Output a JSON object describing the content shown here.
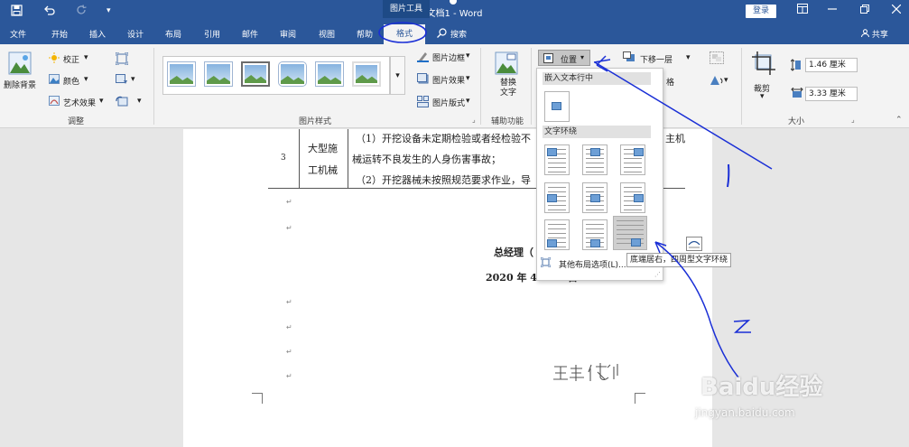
{
  "titlebar": {
    "doc_title": "文档1 - Word",
    "context_tab": "图片工具",
    "login": "登录"
  },
  "tabs": {
    "file": "文件",
    "home": "开始",
    "insert": "插入",
    "design": "设计",
    "layout": "布局",
    "references": "引用",
    "mailings": "邮件",
    "review": "审阅",
    "view": "视图",
    "help": "帮助",
    "format": "格式",
    "search": "搜索",
    "share": "共享"
  },
  "ribbon": {
    "adjust": {
      "remove_bg": "删除背景",
      "corrections": "校正",
      "color": "颜色",
      "artistic": "艺术效果",
      "group_label": "调整"
    },
    "styles": {
      "border": "图片边框",
      "effects": "图片效果",
      "layout": "图片版式",
      "group_label": "图片样式"
    },
    "accessibility": {
      "alt_text": "替换文字",
      "group_label": "辅助功能"
    },
    "arrange": {
      "position": "位置",
      "send_backward": "下移一层",
      "align_partial": "格"
    },
    "size": {
      "crop": "裁剪",
      "height": "1.46 厘米",
      "width": "3.33 厘米",
      "group_label": "大小"
    }
  },
  "position_menu": {
    "inline_header": "嵌入文本行中",
    "wrap_header": "文字环绕",
    "more_options": "其他布局选项(L)...",
    "tooltip": "底端居右，四周型文字环绕"
  },
  "document": {
    "row_number": "3",
    "cell_line1": "大型施",
    "cell_line2": "工机械",
    "text_line1": "（1）开挖设备未定期检验或者经检验不",
    "text_line1_tail": "主机",
    "text_line2": "械运转不良发生的人身伤害事故；",
    "text_line3": "（2）开挖器械未按照规范要求作业，导",
    "signer": "总经理（",
    "date_start": "2020 年 4",
    "date_end": "日",
    "signature": "王丰城"
  },
  "annotations": {
    "mark1": "1",
    "mark2": "2"
  },
  "watermark": {
    "brand": "Baidu经验",
    "url": "jingyan.baidu.com"
  },
  "colors": {
    "title_blue": "#2b579a",
    "ribbon_bg": "#f3f3f3",
    "annotation_ink": "#1a2fd6"
  }
}
